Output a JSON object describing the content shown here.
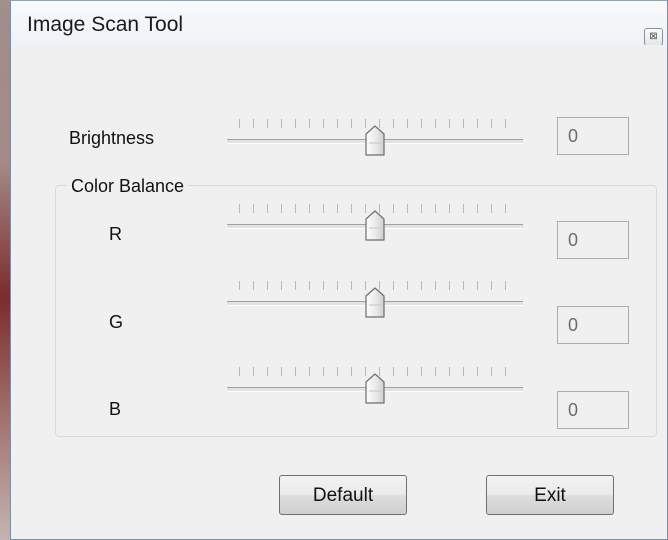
{
  "window": {
    "title": "Image Scan Tool",
    "close_glyph": "⊠"
  },
  "brightness": {
    "label": "Brightness",
    "value": "0"
  },
  "color_balance": {
    "caption": "Color Balance",
    "channels": [
      {
        "label": "R",
        "value": "0"
      },
      {
        "label": "G",
        "value": "0"
      },
      {
        "label": "B",
        "value": "0"
      }
    ]
  },
  "sliders": {
    "range": [
      -100,
      100
    ],
    "brightness_level": 0,
    "r_level": 0,
    "g_level": 0,
    "b_level": 0
  },
  "buttons": {
    "default_label": "Default",
    "exit_label": "Exit"
  },
  "icons": {
    "close": "close-icon",
    "thumb": "slider-thumb-icon"
  },
  "colors": {
    "window_border": "#7a8ea8",
    "background": "#f0f0f0",
    "text": "#111111"
  }
}
